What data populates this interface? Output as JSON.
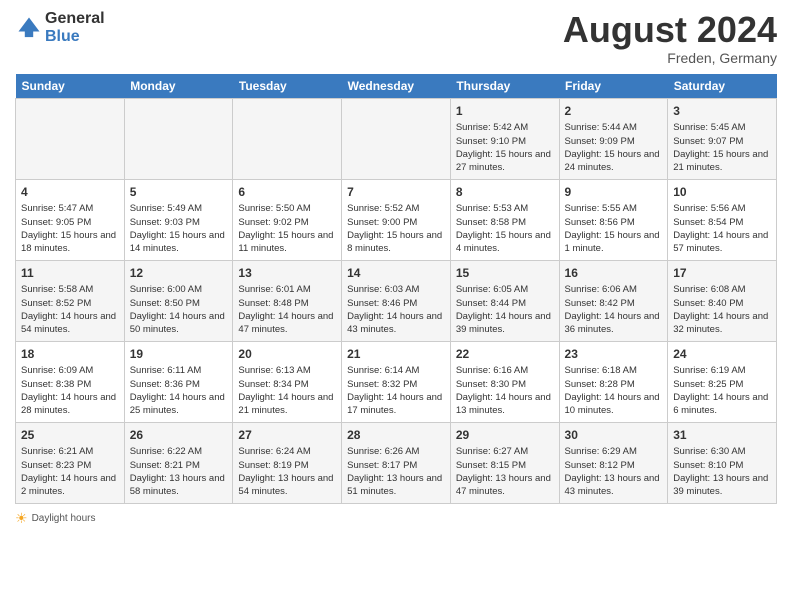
{
  "header": {
    "logo_general": "General",
    "logo_blue": "Blue",
    "month_year": "August 2024",
    "location": "Freden, Germany"
  },
  "days_of_week": [
    "Sunday",
    "Monday",
    "Tuesday",
    "Wednesday",
    "Thursday",
    "Friday",
    "Saturday"
  ],
  "footer_text": "Daylight hours",
  "weeks": [
    [
      {
        "day": "",
        "content": ""
      },
      {
        "day": "",
        "content": ""
      },
      {
        "day": "",
        "content": ""
      },
      {
        "day": "",
        "content": ""
      },
      {
        "day": "1",
        "content": "Sunrise: 5:42 AM\nSunset: 9:10 PM\nDaylight: 15 hours and 27 minutes."
      },
      {
        "day": "2",
        "content": "Sunrise: 5:44 AM\nSunset: 9:09 PM\nDaylight: 15 hours and 24 minutes."
      },
      {
        "day": "3",
        "content": "Sunrise: 5:45 AM\nSunset: 9:07 PM\nDaylight: 15 hours and 21 minutes."
      }
    ],
    [
      {
        "day": "4",
        "content": "Sunrise: 5:47 AM\nSunset: 9:05 PM\nDaylight: 15 hours and 18 minutes."
      },
      {
        "day": "5",
        "content": "Sunrise: 5:49 AM\nSunset: 9:03 PM\nDaylight: 15 hours and 14 minutes."
      },
      {
        "day": "6",
        "content": "Sunrise: 5:50 AM\nSunset: 9:02 PM\nDaylight: 15 hours and 11 minutes."
      },
      {
        "day": "7",
        "content": "Sunrise: 5:52 AM\nSunset: 9:00 PM\nDaylight: 15 hours and 8 minutes."
      },
      {
        "day": "8",
        "content": "Sunrise: 5:53 AM\nSunset: 8:58 PM\nDaylight: 15 hours and 4 minutes."
      },
      {
        "day": "9",
        "content": "Sunrise: 5:55 AM\nSunset: 8:56 PM\nDaylight: 15 hours and 1 minute."
      },
      {
        "day": "10",
        "content": "Sunrise: 5:56 AM\nSunset: 8:54 PM\nDaylight: 14 hours and 57 minutes."
      }
    ],
    [
      {
        "day": "11",
        "content": "Sunrise: 5:58 AM\nSunset: 8:52 PM\nDaylight: 14 hours and 54 minutes."
      },
      {
        "day": "12",
        "content": "Sunrise: 6:00 AM\nSunset: 8:50 PM\nDaylight: 14 hours and 50 minutes."
      },
      {
        "day": "13",
        "content": "Sunrise: 6:01 AM\nSunset: 8:48 PM\nDaylight: 14 hours and 47 minutes."
      },
      {
        "day": "14",
        "content": "Sunrise: 6:03 AM\nSunset: 8:46 PM\nDaylight: 14 hours and 43 minutes."
      },
      {
        "day": "15",
        "content": "Sunrise: 6:05 AM\nSunset: 8:44 PM\nDaylight: 14 hours and 39 minutes."
      },
      {
        "day": "16",
        "content": "Sunrise: 6:06 AM\nSunset: 8:42 PM\nDaylight: 14 hours and 36 minutes."
      },
      {
        "day": "17",
        "content": "Sunrise: 6:08 AM\nSunset: 8:40 PM\nDaylight: 14 hours and 32 minutes."
      }
    ],
    [
      {
        "day": "18",
        "content": "Sunrise: 6:09 AM\nSunset: 8:38 PM\nDaylight: 14 hours and 28 minutes."
      },
      {
        "day": "19",
        "content": "Sunrise: 6:11 AM\nSunset: 8:36 PM\nDaylight: 14 hours and 25 minutes."
      },
      {
        "day": "20",
        "content": "Sunrise: 6:13 AM\nSunset: 8:34 PM\nDaylight: 14 hours and 21 minutes."
      },
      {
        "day": "21",
        "content": "Sunrise: 6:14 AM\nSunset: 8:32 PM\nDaylight: 14 hours and 17 minutes."
      },
      {
        "day": "22",
        "content": "Sunrise: 6:16 AM\nSunset: 8:30 PM\nDaylight: 14 hours and 13 minutes."
      },
      {
        "day": "23",
        "content": "Sunrise: 6:18 AM\nSunset: 8:28 PM\nDaylight: 14 hours and 10 minutes."
      },
      {
        "day": "24",
        "content": "Sunrise: 6:19 AM\nSunset: 8:25 PM\nDaylight: 14 hours and 6 minutes."
      }
    ],
    [
      {
        "day": "25",
        "content": "Sunrise: 6:21 AM\nSunset: 8:23 PM\nDaylight: 14 hours and 2 minutes."
      },
      {
        "day": "26",
        "content": "Sunrise: 6:22 AM\nSunset: 8:21 PM\nDaylight: 13 hours and 58 minutes."
      },
      {
        "day": "27",
        "content": "Sunrise: 6:24 AM\nSunset: 8:19 PM\nDaylight: 13 hours and 54 minutes."
      },
      {
        "day": "28",
        "content": "Sunrise: 6:26 AM\nSunset: 8:17 PM\nDaylight: 13 hours and 51 minutes."
      },
      {
        "day": "29",
        "content": "Sunrise: 6:27 AM\nSunset: 8:15 PM\nDaylight: 13 hours and 47 minutes."
      },
      {
        "day": "30",
        "content": "Sunrise: 6:29 AM\nSunset: 8:12 PM\nDaylight: 13 hours and 43 minutes."
      },
      {
        "day": "31",
        "content": "Sunrise: 6:30 AM\nSunset: 8:10 PM\nDaylight: 13 hours and 39 minutes."
      }
    ]
  ]
}
